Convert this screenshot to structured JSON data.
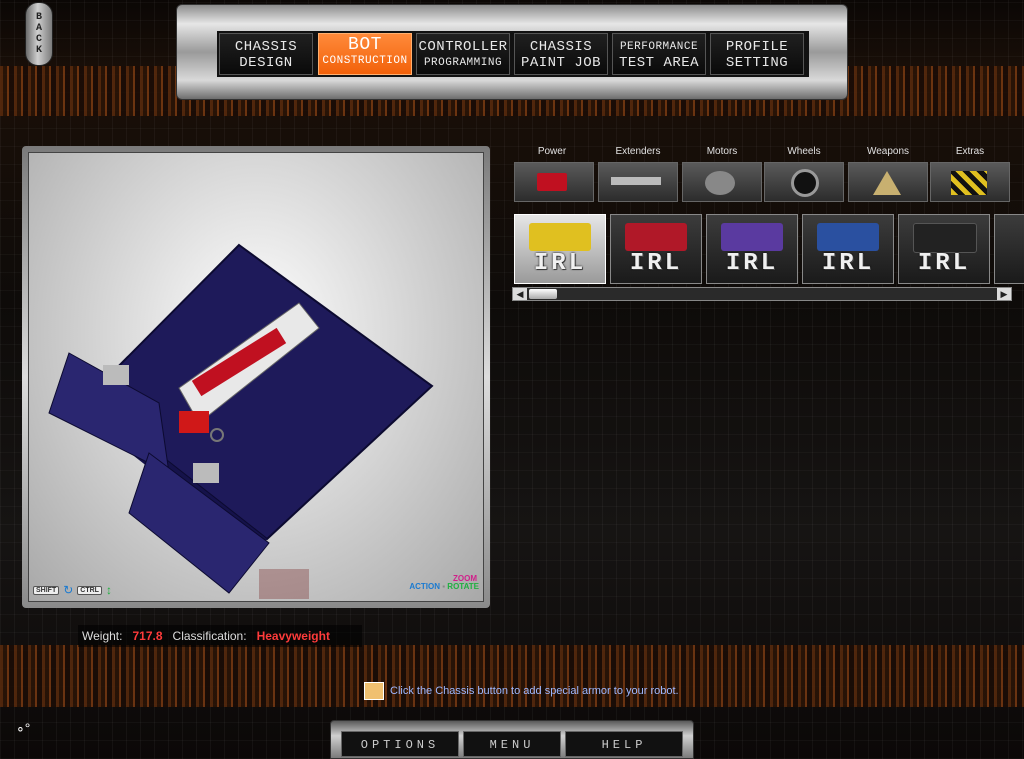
{
  "back_button": {
    "label": [
      "B",
      "A",
      "C",
      "K"
    ]
  },
  "tabs": [
    {
      "line1": "CHASSIS",
      "line2": "DESIGN",
      "active": false
    },
    {
      "line1": "BOT",
      "line2": "CONSTRUCTION",
      "active": true
    },
    {
      "line1": "CONTROLLER",
      "line2": "PROGRAMMING",
      "active": false
    },
    {
      "line1": "CHASSIS",
      "line2": "PAINT JOB",
      "active": false
    },
    {
      "line1": "PERFORMANCE",
      "line2": "TEST AREA",
      "active": false
    },
    {
      "line1": "PROFILE",
      "line2": "SETTING",
      "active": false
    }
  ],
  "viewport": {
    "shift_key": "SHIFT",
    "ctrl_key": "CTRL",
    "action_label": "ACTION",
    "zoom_label": "ZOOM",
    "rotate_label": "ROTATE"
  },
  "categories": [
    "Power",
    "Extenders",
    "Motors",
    "Wheels",
    "Weapons",
    "Extras"
  ],
  "parts": [
    {
      "label": "IRL",
      "color": "#e0c020",
      "selected": true
    },
    {
      "label": "IRL",
      "color": "#b01828",
      "selected": false
    },
    {
      "label": "IRL",
      "color": "#5a3aa0",
      "selected": false
    },
    {
      "label": "IRL",
      "color": "#2a50a0",
      "selected": false
    },
    {
      "label": "IRL",
      "color": "#222222",
      "selected": false
    }
  ],
  "stats": {
    "weight_label": "Weight:",
    "weight_value": "717.8",
    "class_label": "Classification:",
    "class_value": "Heavyweight"
  },
  "hint": {
    "text": "Click the Chassis button to add special armor to your robot."
  },
  "bottom_menu": [
    "OPTIONS",
    "MENU",
    "HELP"
  ]
}
